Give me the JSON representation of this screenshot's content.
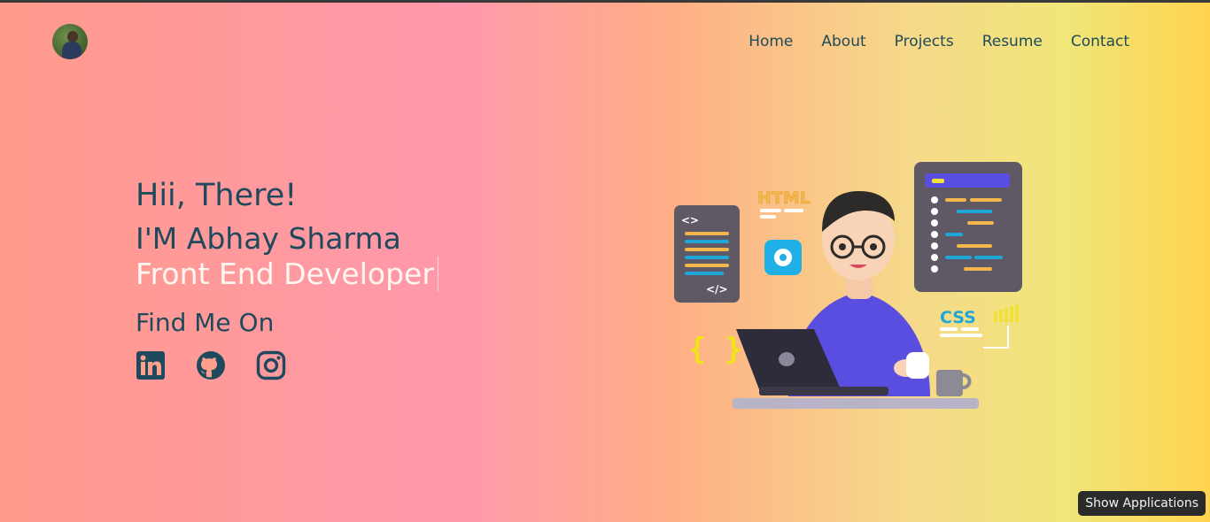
{
  "nav": {
    "items": [
      {
        "label": "Home"
      },
      {
        "label": "About"
      },
      {
        "label": "Projects"
      },
      {
        "label": "Resume"
      },
      {
        "label": "Contact"
      }
    ]
  },
  "hero": {
    "greeting": "Hii, There!",
    "name": "I'M Abhay Sharma",
    "role": "Front End Developer",
    "find_me": "Find Me On"
  },
  "socials": [
    {
      "icon": "linkedin-icon"
    },
    {
      "icon": "github-icon"
    },
    {
      "icon": "instagram-icon"
    }
  ],
  "illustration": {
    "html_label": "HTML",
    "css_label": "CSS",
    "code_open": "<>",
    "code_close": "</>",
    "braces": "{ }"
  },
  "taskbar": {
    "show_apps": "Show Applications"
  },
  "colors": {
    "text": "#1f4a5e",
    "role_text": "#fff7f2",
    "css_badge": "#1fa7d9",
    "html_badge": "#f3b64a"
  }
}
